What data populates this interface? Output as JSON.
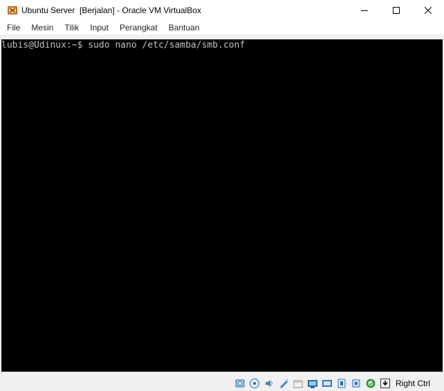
{
  "window": {
    "title": "Ubuntu Server  [Berjalan] - Oracle VM VirtualBox",
    "controls": [
      "minimize",
      "maximize",
      "close"
    ]
  },
  "menu": {
    "items": [
      "File",
      "Mesin",
      "Tilik",
      "Input",
      "Perangkat",
      "Bantuan"
    ]
  },
  "terminal": {
    "lines": [
      "lubis@Udinux:~$ sudo nano /etc/samba/smb.conf"
    ]
  },
  "statusbar": {
    "icons": [
      "hard-disk-icon",
      "optical-drive-icon",
      "audio-icon",
      "network-icon",
      "usb-icon",
      "shared-folders-icon",
      "display-icon",
      "video-capture-icon",
      "cpu-icon",
      "mouse-integration-icon",
      "keyboard-capture-icon"
    ],
    "host_key": "Right Ctrl"
  },
  "colors": {
    "terminal_bg": "#000000",
    "terminal_fg": "#c0c0c0",
    "chrome_bg": "#f0f0f0"
  }
}
